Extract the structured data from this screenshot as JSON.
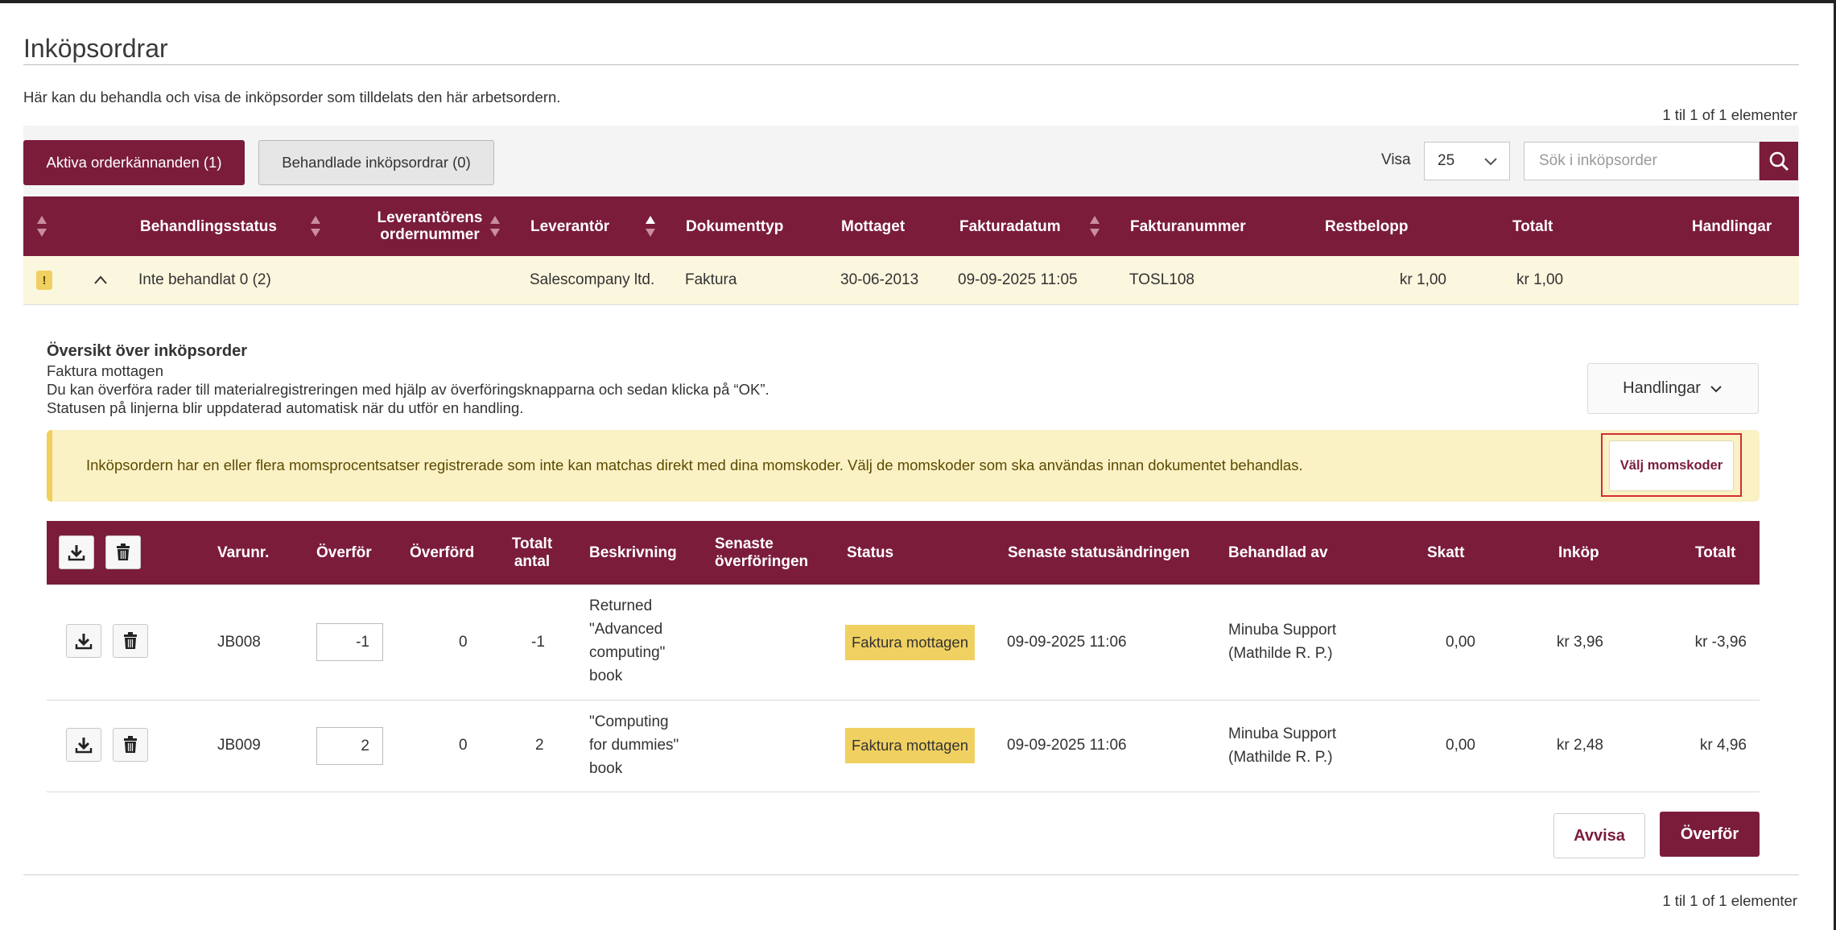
{
  "page": {
    "title": "Inköpsordrar",
    "intro": "Här kan du behandla och visa de inköpsorder som tilldelats den här arbetsordern.",
    "count_top": "1 til 1 of 1 elementer",
    "count_bottom": "1 til 1 of 1 elementer"
  },
  "tabs": {
    "active_label": "Aktiva orderkännanden (1)",
    "inactive_label": "Behandlade inköpsordrar (0)"
  },
  "toolbar": {
    "visa_label": "Visa",
    "page_size": "25",
    "search_placeholder": "Sök i inköpsorder"
  },
  "orders_table": {
    "headers": {
      "status": "Behandlingsstatus",
      "supplier_order_line1": "Leverantörens",
      "supplier_order_line2": "ordernummer",
      "supplier": "Leverantör",
      "doc_type": "Dokumenttyp",
      "received": "Mottaget",
      "invoice_date": "Fakturadatum",
      "invoice_no": "Fakturanummer",
      "remaining": "Restbelopp",
      "total": "Totalt",
      "actions": "Handlingar"
    },
    "row": {
      "warning": "!",
      "status": "Inte behandlat 0 (2)",
      "supplier": "Salescompany ltd.",
      "doc_type": "Faktura",
      "received": "30-06-2013",
      "invoice_date": "09-09-2025 11:05",
      "invoice_no": "TOSL108",
      "remaining": "kr 1,00",
      "total": "kr 1,00"
    }
  },
  "overview": {
    "title": "Översikt över inköpsorder",
    "line1": "Faktura mottagen",
    "line2": "Du kan överföra rader till materialregistreringen med hjälp av överföringsknapparna och sedan klicka på “OK”.",
    "line3": "Statusen på linjerna blir uppdaterad automatisk när du utför en handling.",
    "actions_button": "Handlingar"
  },
  "alert": {
    "text": "Inköpsordern har en eller flera momsprocentsatser registrerade som inte kan matchas direkt med dina momskoder. Välj de momskoder som ska användas innan dokumentet behandlas.",
    "button": "Välj momskoder"
  },
  "lines_table": {
    "headers": {
      "item_no": "Varunr.",
      "transfer": "Överför",
      "transferred": "Överförd",
      "total_qty_line1": "Totalt",
      "total_qty_line2": "antal",
      "description": "Beskrivning",
      "last_transfer_line1": "Senaste",
      "last_transfer_line2": "överföringen",
      "status": "Status",
      "last_status_change": "Senaste statusändringen",
      "handled_by": "Behandlad av",
      "tax": "Skatt",
      "purchase": "Inköp",
      "total": "Totalt"
    },
    "rows": [
      {
        "item_no": "JB008",
        "transfer_qty": "-1",
        "transferred": "0",
        "total_qty": "-1",
        "desc_line1": "Returned",
        "desc_line2": "\"Advanced",
        "desc_line3": "computing\"",
        "desc_line4": "book",
        "status": "Faktura mottagen",
        "last_status_change": "09-09-2025 11:06",
        "handled_by_line1": "Minuba Support",
        "handled_by_line2": "(Mathilde R. P.)",
        "tax": "0,00",
        "purchase": "kr 3,96",
        "total": "kr -3,96"
      },
      {
        "item_no": "JB009",
        "transfer_qty": "2",
        "transferred": "0",
        "total_qty": "2",
        "desc_line1": "\"Computing",
        "desc_line2": "for dummies\"",
        "desc_line3": "book",
        "status": "Faktura mottagen",
        "last_status_change": "09-09-2025 11:06",
        "handled_by_line1": "Minuba Support",
        "handled_by_line2": "(Mathilde R. P.)",
        "tax": "0,00",
        "purchase": "kr 2,48",
        "total": "kr 4,96"
      }
    ]
  },
  "footer": {
    "reject_button": "Avvisa",
    "transfer_button": "Överför"
  },
  "colors": {
    "brand": "#7b1c3b",
    "warning_bg": "#fbf6de",
    "status_badge": "#f0d060",
    "highlight_outline": "#d32f2f"
  }
}
